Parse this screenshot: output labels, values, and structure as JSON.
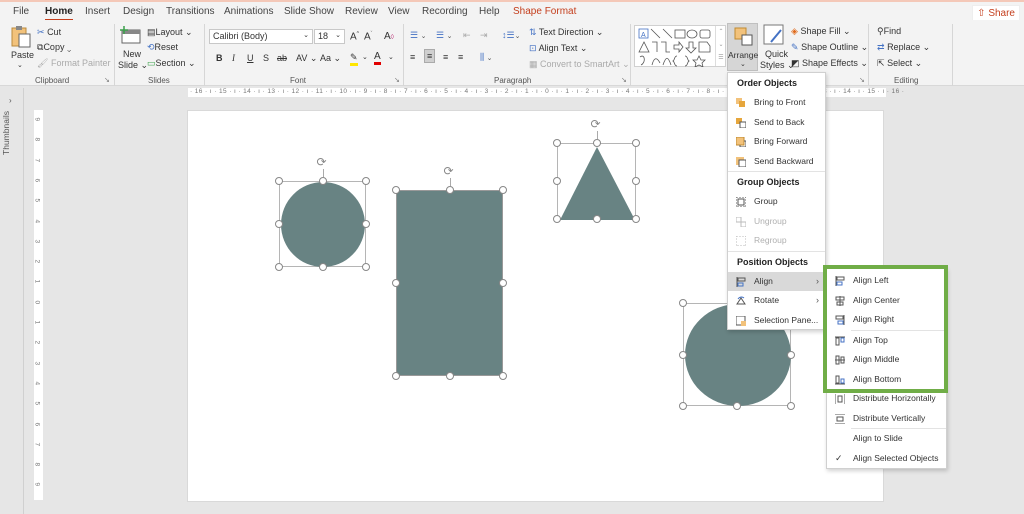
{
  "menu_tabs": [
    "File",
    "Home",
    "Insert",
    "Design",
    "Transitions",
    "Animations",
    "Slide Show",
    "Review",
    "View",
    "Recording",
    "Help",
    "Shape Format"
  ],
  "active_tab": "Home",
  "share_label": "Share",
  "clipboard": {
    "paste": "Paste",
    "cut": "Cut",
    "copy": "Copy",
    "format_painter": "Format Painter",
    "label": "Clipboard"
  },
  "slides_group": {
    "new_slide_1": "New",
    "new_slide_2": "Slide",
    "layout": "Layout",
    "reset": "Reset",
    "section": "Section",
    "label": "Slides"
  },
  "font_group": {
    "font_name": "Calibri (Body)",
    "font_size": "18",
    "bold": "B",
    "italic": "I",
    "underline": "U",
    "shadow": "S",
    "strike": "ab",
    "spacing": "AV",
    "case": "Aa",
    "label": "Font"
  },
  "paragraph_group": {
    "text_direction": "Text Direction",
    "align_text": "Align Text",
    "convert_smartart": "Convert to SmartArt",
    "label": "Paragraph"
  },
  "drawing_group": {
    "arrange_label": "Arrange",
    "quick_styles_1": "Quick",
    "quick_styles_2": "Styles",
    "shape_fill": "Shape Fill",
    "shape_outline": "Shape Outline",
    "shape_effects": "Shape Effects"
  },
  "editing_group": {
    "find": "Find",
    "replace": "Replace",
    "select": "Select",
    "label": "Editing"
  },
  "thumbnails_label": "Thumbnails",
  "ruler": {
    "horizontal": "· 16 · ı · 15 · ı · 14 · ı · 13 · ı · 12 · ı · 11 · ı · 10 · ı · 9 · ı · 8 · ı · 7 · ı · 6 · ı · 5 · ı · 4 · ı · 3 · ı · 2 · ı · 1 · ı · 0 · ı · 1 · ı · 2 · ı · 3 · ı · 4 · ı · 5 · ı · 6 · ı · 7 · ı · 8 · ı · 9 · ı · 10 · ı · 11 · ı · 12 · ı · 13 · ı · 14 · ı · 15 · ı · 16 ·",
    "vertical": [
      "9",
      "8",
      "7",
      "6",
      "5",
      "4",
      "3",
      "2",
      "1",
      "0",
      "1",
      "2",
      "3",
      "4",
      "5",
      "6",
      "7",
      "8",
      "9"
    ]
  },
  "shape_color": "#688383",
  "accent_color": "#c43e1c",
  "highlight_green": "#70ad47",
  "arrange_menu": {
    "order_header": "Order Objects",
    "order_items": [
      "Bring to Front",
      "Send to Back",
      "Bring Forward",
      "Send Backward"
    ],
    "group_header": "Group Objects",
    "group_items": [
      "Group",
      "Ungroup",
      "Regroup"
    ],
    "position_header": "Position Objects",
    "position_items": [
      "Align",
      "Rotate",
      "Selection Pane..."
    ]
  },
  "align_submenu": {
    "items": [
      "Align Left",
      "Align Center",
      "Align Right",
      "Align Top",
      "Align Middle",
      "Align Bottom",
      "Distribute Horizontally",
      "Distribute Vertically",
      "Align to Slide",
      "Align Selected Objects"
    ],
    "checked": "Align Selected Objects"
  }
}
